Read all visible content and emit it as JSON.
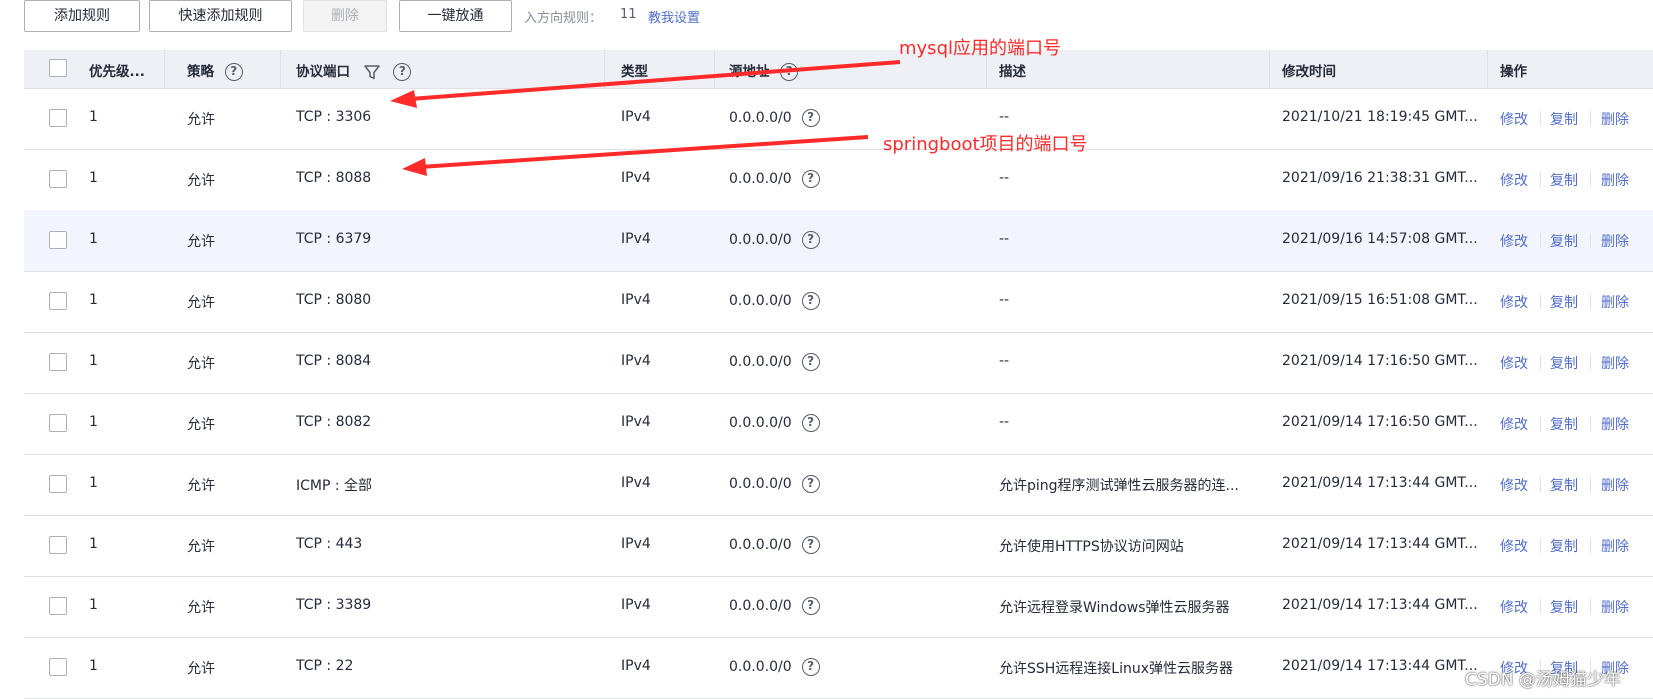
{
  "toolbar": {
    "add_rule": "添加规则",
    "quick_add_rule": "快速添加规则",
    "delete": "删除",
    "one_click_open": "一键放通",
    "inbound_rules_label": "入方向规则：",
    "inbound_rules_count": "11",
    "help_link": "教我设置"
  },
  "table": {
    "headers": {
      "priority": "优先级...",
      "policy": "策略",
      "protocol_port": "协议端口",
      "type": "类型",
      "source": "源地址",
      "description": "描述",
      "modified_time": "修改时间",
      "actions": "操作"
    },
    "action_labels": {
      "edit": "修改",
      "copy": "复制",
      "delete": "删除"
    },
    "rows": [
      {
        "priority": "1",
        "policy": "允许",
        "port": "TCP : 3306",
        "type": "IPv4",
        "source": "0.0.0.0/0",
        "description": "--",
        "modified": "2021/10/21 18:19:45 GMT..."
      },
      {
        "priority": "1",
        "policy": "允许",
        "port": "TCP : 8088",
        "type": "IPv4",
        "source": "0.0.0.0/0",
        "description": "--",
        "modified": "2021/09/16 21:38:31 GMT..."
      },
      {
        "priority": "1",
        "policy": "允许",
        "port": "TCP : 6379",
        "type": "IPv4",
        "source": "0.0.0.0/0",
        "description": "--",
        "modified": "2021/09/16 14:57:08 GMT...",
        "highlighted": true
      },
      {
        "priority": "1",
        "policy": "允许",
        "port": "TCP : 8080",
        "type": "IPv4",
        "source": "0.0.0.0/0",
        "description": "--",
        "modified": "2021/09/15 16:51:08 GMT..."
      },
      {
        "priority": "1",
        "policy": "允许",
        "port": "TCP : 8084",
        "type": "IPv4",
        "source": "0.0.0.0/0",
        "description": "--",
        "modified": "2021/09/14 17:16:50 GMT..."
      },
      {
        "priority": "1",
        "policy": "允许",
        "port": "TCP : 8082",
        "type": "IPv4",
        "source": "0.0.0.0/0",
        "description": "--",
        "modified": "2021/09/14 17:16:50 GMT..."
      },
      {
        "priority": "1",
        "policy": "允许",
        "port": "ICMP : 全部",
        "type": "IPv4",
        "source": "0.0.0.0/0",
        "description": "允许ping程序测试弹性云服务器的连...",
        "modified": "2021/09/14 17:13:44 GMT..."
      },
      {
        "priority": "1",
        "policy": "允许",
        "port": "TCP : 443",
        "type": "IPv4",
        "source": "0.0.0.0/0",
        "description": "允许使用HTTPS协议访问网站",
        "modified": "2021/09/14 17:13:44 GMT..."
      },
      {
        "priority": "1",
        "policy": "允许",
        "port": "TCP : 3389",
        "type": "IPv4",
        "source": "0.0.0.0/0",
        "description": "允许远程登录Windows弹性云服务器",
        "modified": "2021/09/14 17:13:44 GMT..."
      },
      {
        "priority": "1",
        "policy": "允许",
        "port": "TCP : 22",
        "type": "IPv4",
        "source": "0.0.0.0/0",
        "description": "允许SSH远程连接Linux弹性云服务器",
        "modified": "2021/09/14 17:13:44 GMT..."
      }
    ]
  },
  "annotations": {
    "mysql_port": "mysql应用的端口号",
    "springboot_port": "springboot项目的端口号"
  },
  "watermark": "CSDN @汤姆猫少年",
  "colors": {
    "link": "#526ecc",
    "header_bg": "#eef0f5",
    "highlight_row": "#f2f5fc",
    "annotation": "#ff2a2a"
  },
  "icons": {
    "help": "question-circle-icon",
    "filter": "filter-icon",
    "arrow": "red-arrow"
  }
}
